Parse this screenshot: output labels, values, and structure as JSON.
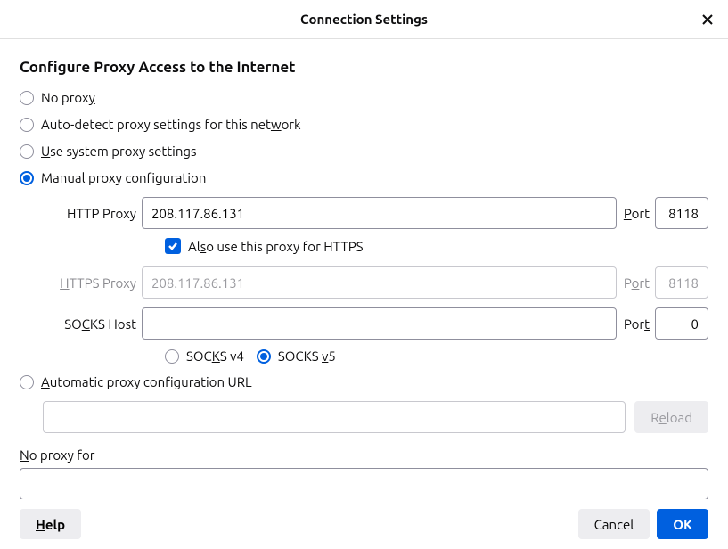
{
  "dialog": {
    "title": "Connection Settings",
    "heading": "Configure Proxy Access to the Internet"
  },
  "radios": {
    "no_proxy": {
      "pre": "No prox",
      "accel": "y",
      "post": ""
    },
    "auto_detect": {
      "pre": "Auto-detect proxy settings for this net",
      "accel": "w",
      "post": "ork"
    },
    "system": {
      "pre": "",
      "accel": "U",
      "post": "se system proxy settings"
    },
    "manual": {
      "pre": "",
      "accel": "M",
      "post": "anual proxy configuration"
    },
    "pac": {
      "pre": "",
      "accel": "A",
      "post": "utomatic proxy configuration URL"
    }
  },
  "manual": {
    "http": {
      "label": "HTTP Proxy",
      "host": "208.117.86.131",
      "port_label_pre": "",
      "port_accel": "P",
      "port_label_post": "ort",
      "port": "8118"
    },
    "share": {
      "pre": "Al",
      "accel": "s",
      "post": "o use this proxy for HTTPS"
    },
    "https": {
      "label_accel": "H",
      "label_post": "TTPS Proxy",
      "host_placeholder": "208.117.86.131",
      "port_label_pre": "P",
      "port_accel": "o",
      "port_label_post": "rt",
      "port_placeholder": "8118"
    },
    "socks": {
      "label_pre": "SO",
      "label_accel": "C",
      "label_post": "KS Host",
      "host": "",
      "port_label_pre": "Por",
      "port_accel": "t",
      "port_label_post": "",
      "port": "0",
      "v4": {
        "pre": "SOC",
        "accel": "K",
        "post": "S v4"
      },
      "v5": {
        "pre": "SOCKS ",
        "accel": "v",
        "post": "5"
      }
    }
  },
  "pac": {
    "url": "",
    "reload_pre": "R",
    "reload_accel": "e",
    "reload_post": "load"
  },
  "no_proxy_for": {
    "label_accel": "N",
    "label_post": "o proxy for",
    "value": ""
  },
  "footer": {
    "help_accel": "H",
    "help_post": "elp",
    "cancel": "Cancel",
    "ok": "OK"
  }
}
